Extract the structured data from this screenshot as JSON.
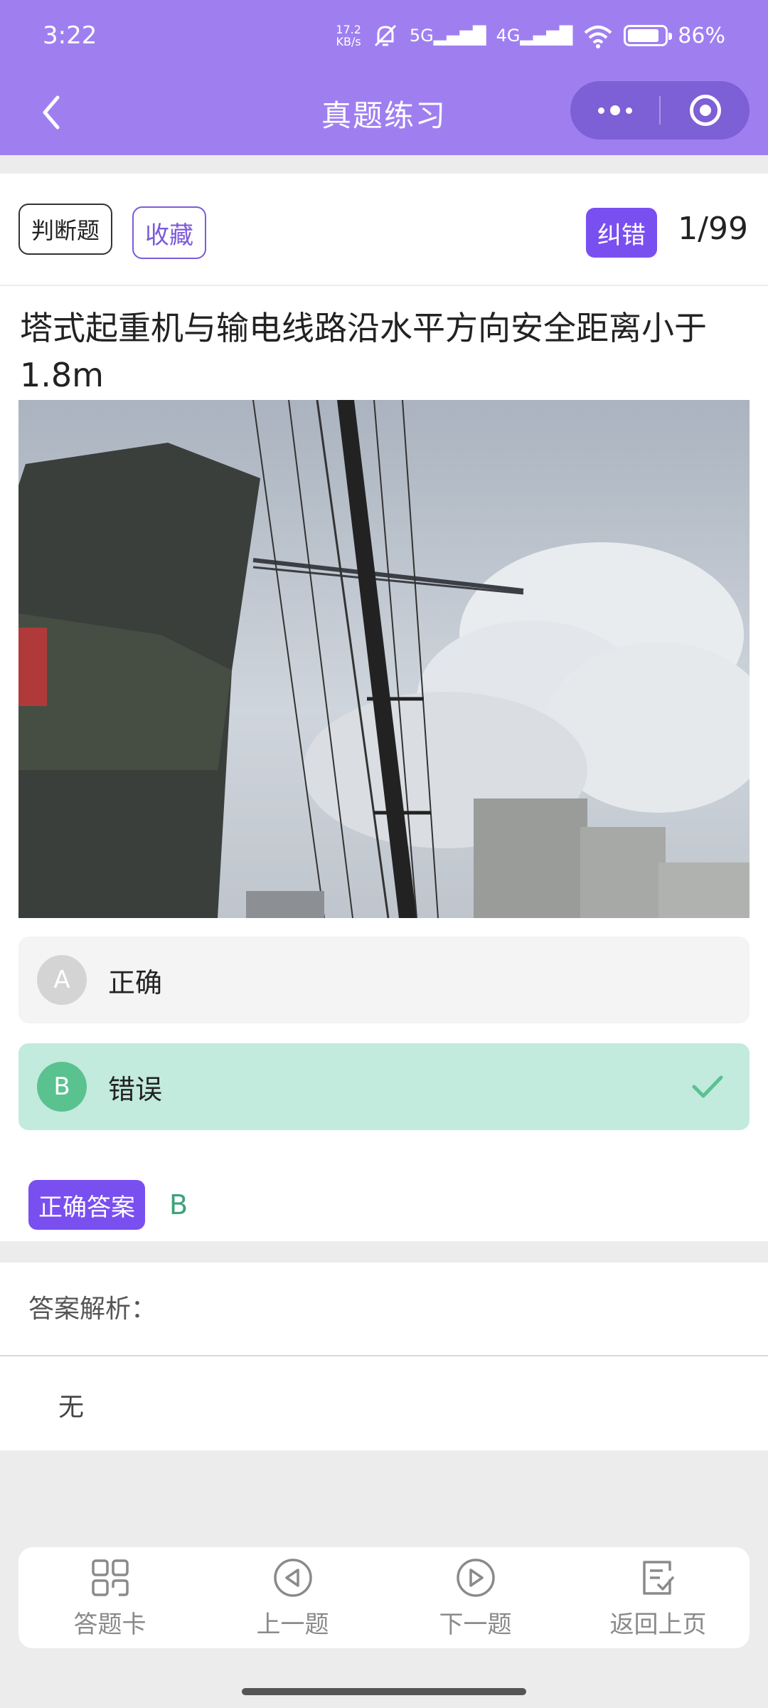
{
  "status_bar": {
    "time": "3:22",
    "net_speed_value": "17.2",
    "net_speed_unit": "KB/s",
    "sig1": "5G",
    "sig2": "4G",
    "battery": "86",
    "battery_unit": "%"
  },
  "header": {
    "title": "真题练习"
  },
  "question_card": {
    "type_tag": "判断题",
    "favorite_label": "收藏",
    "report_error_label": "纠错",
    "progress": "1/99",
    "question_text": "塔式起重机与输电线路沿水平方向安全距离小于1.8m",
    "options": [
      {
        "letter": "A",
        "text": "正确",
        "selected": false
      },
      {
        "letter": "B",
        "text": "错误",
        "selected": true
      }
    ],
    "correct_answer_label": "正确答案",
    "correct_answer_value": "B"
  },
  "analysis": {
    "title": "答案解析：",
    "body": "无"
  },
  "bottom_nav": [
    {
      "label": "答题卡",
      "icon": "grid-icon"
    },
    {
      "label": "上一题",
      "icon": "previous-circle-icon"
    },
    {
      "label": "下一题",
      "icon": "next-circle-icon"
    },
    {
      "label": "返回上页",
      "icon": "return-list-icon"
    }
  ],
  "colors": {
    "header_bg": "#9f7ff0",
    "accent": "#7a4ff0",
    "correct_green": "#5ac28f",
    "correct_bg": "#c2eadd"
  }
}
